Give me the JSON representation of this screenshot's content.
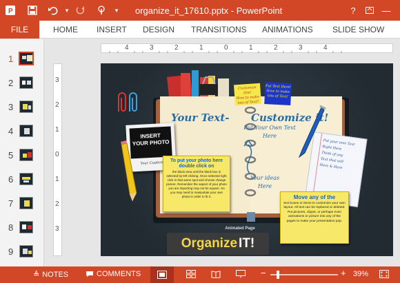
{
  "window": {
    "title": "organize_it_17610.pptx - PowerPoint",
    "buttons": {
      "help": "?",
      "minimize": "—",
      "restore": "❐"
    }
  },
  "quick_access": {
    "save_icon": "save-icon",
    "undo_icon": "undo-icon",
    "redo_icon": "redo-icon",
    "touch_icon": "touch-mode-icon"
  },
  "ribbon": {
    "file": "FILE",
    "tabs": [
      "HOME",
      "INSERT",
      "DESIGN",
      "TRANSITIONS",
      "ANIMATIONS",
      "SLIDE SHOW"
    ]
  },
  "thumbnails": {
    "numbers": [
      "1",
      "2",
      "3",
      "4",
      "5",
      "6",
      "7",
      "8",
      "9"
    ],
    "selected": "1"
  },
  "rulers": {
    "horizontal": [
      "4",
      "3",
      "2",
      "1",
      "0",
      "1",
      "2",
      "3",
      "4"
    ],
    "vertical": [
      "3",
      "2",
      "1",
      "0",
      "1",
      "2",
      "3"
    ]
  },
  "slide": {
    "photo_label_1": "INSERT",
    "photo_label_2": "YOUR PHOTO",
    "photo_caption": "Your Caption",
    "your_text": "Your Text-",
    "customize_it": "Customize it!",
    "put_text_1": "Put Your Own Text",
    "put_text_2": "Here",
    "your_ideas_1": "Your ideas",
    "your_ideas_2": "Here",
    "sticky_yellow_1": "Customize this!",
    "sticky_yellow_2": "How to make",
    "sticky_yellow_3": "lots of Text?",
    "sticky_blue_1": "Put Text Here!",
    "sticky_blue_2": "How to make",
    "sticky_blue_3": "lots of Text!",
    "note1_title_1": "To put your photo here",
    "note1_title_2": "double click on",
    "note1_body": "the black area until the black box is selected by left clicking. Once selected right click in that same spot and choose change picture. Remember the aspect of your photo you are importing may not be square. So you may need to manipulate your own photo in order to fit it.",
    "note2_title_1": "Move any of the",
    "note2_body": "text boxes or items to customize your own layout. All text can be replaced or deleted. Put pictures, clipart, or perhaps even animations or picture into any of the pages to make your presentation pop.",
    "paper_lines": [
      "Put your own Text",
      "Right Here",
      "Think of any",
      "Text that will",
      "Here & Here"
    ],
    "animated_page": "Animated Page",
    "logo_organize": "Organize",
    "logo_it": "IT!"
  },
  "statusbar": {
    "notes": "NOTES",
    "comments": "COMMENTS",
    "zoom": "39%",
    "minus": "−",
    "plus": "+"
  },
  "colors": {
    "accent": "#d24726",
    "note": "#f7e86a",
    "slide_bg": "#263038"
  }
}
